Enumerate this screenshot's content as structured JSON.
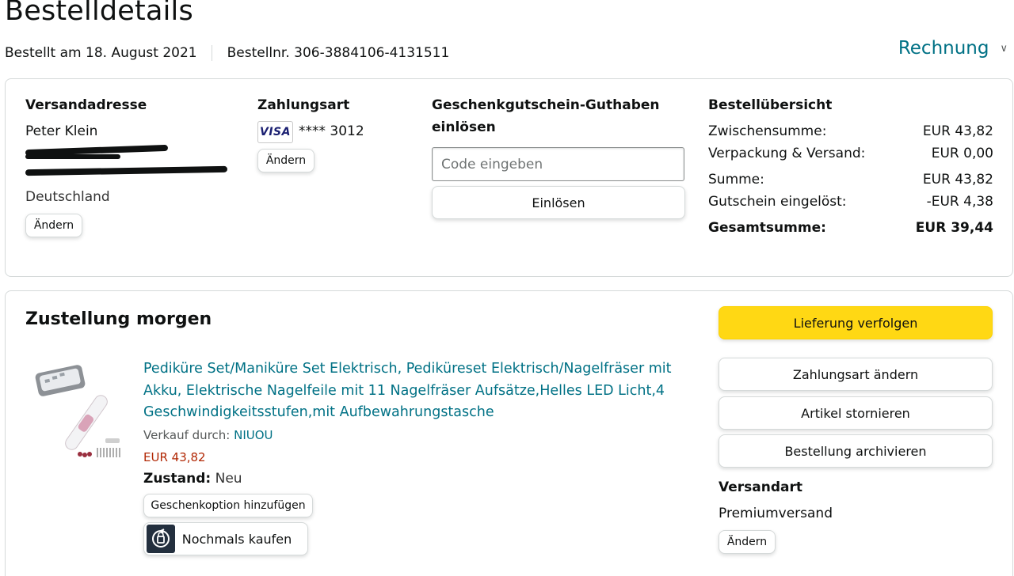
{
  "page": {
    "title": "Bestelldetails",
    "ordered_on": "Bestellt am 18. August 2021",
    "order_number": "Bestellnr. 306-3884106-4131511",
    "invoice_label": "Rechnung"
  },
  "summary_box": {
    "shipping": {
      "heading": "Versandadresse",
      "name": "Peter Klein",
      "country": "Deutschland",
      "change_label": "Ändern"
    },
    "payment": {
      "heading": "Zahlungsart",
      "card_brand": "VISA",
      "card_number": "**** 3012",
      "change_label": "Ändern"
    },
    "gift_card": {
      "heading_line1": "Geschenkgutschein-Guthaben",
      "heading_line2": "einlösen",
      "input_placeholder": "Code eingeben",
      "redeem_label": "Einlösen"
    },
    "order_summary": {
      "heading": "Bestellübersicht",
      "rows": [
        {
          "label": "Zwischensumme:",
          "value": "EUR 43,82"
        },
        {
          "label": "Verpackung & Versand:",
          "value": "EUR 0,00"
        },
        {
          "label": "Summe:",
          "value": "EUR 43,82"
        },
        {
          "label": "Gutschein eingelöst:",
          "value": "-EUR 4,38"
        }
      ],
      "total_label": "Gesamtsumme:",
      "total_value": "EUR 39,44"
    }
  },
  "delivery": {
    "heading": "Zustellung morgen",
    "product_title": "Pediküre Set/Maniküre Set Elektrisch, Pediküreset Elektrisch/Nagelfräser mit Akku, Elektrische Nagelfeile mit 11 Nagelfräser Aufsätze,Helles LED Licht,4 Geschwindigkeitsstufen,mit Aufbewahrungstasche",
    "sold_by_label": "Verkauf durch:",
    "seller": "NIUOU",
    "price": "EUR 43,82",
    "condition_label": "Zustand:",
    "condition_value": "Neu",
    "gift_option_label": "Geschenkoption hinzufügen",
    "buy_again_label": "Nochmals kaufen",
    "actions": {
      "track": "Lieferung verfolgen",
      "change_payment": "Zahlungsart ändern",
      "cancel": "Artikel stornieren",
      "archive": "Bestellung archivieren"
    },
    "shipping_method": {
      "heading": "Versandart",
      "value": "Premiumversand",
      "change_label": "Ändern"
    }
  },
  "colors": {
    "link": "#007185",
    "price": "#b12704",
    "primary_button": "#ffd814",
    "border": "#d5d9d9"
  }
}
